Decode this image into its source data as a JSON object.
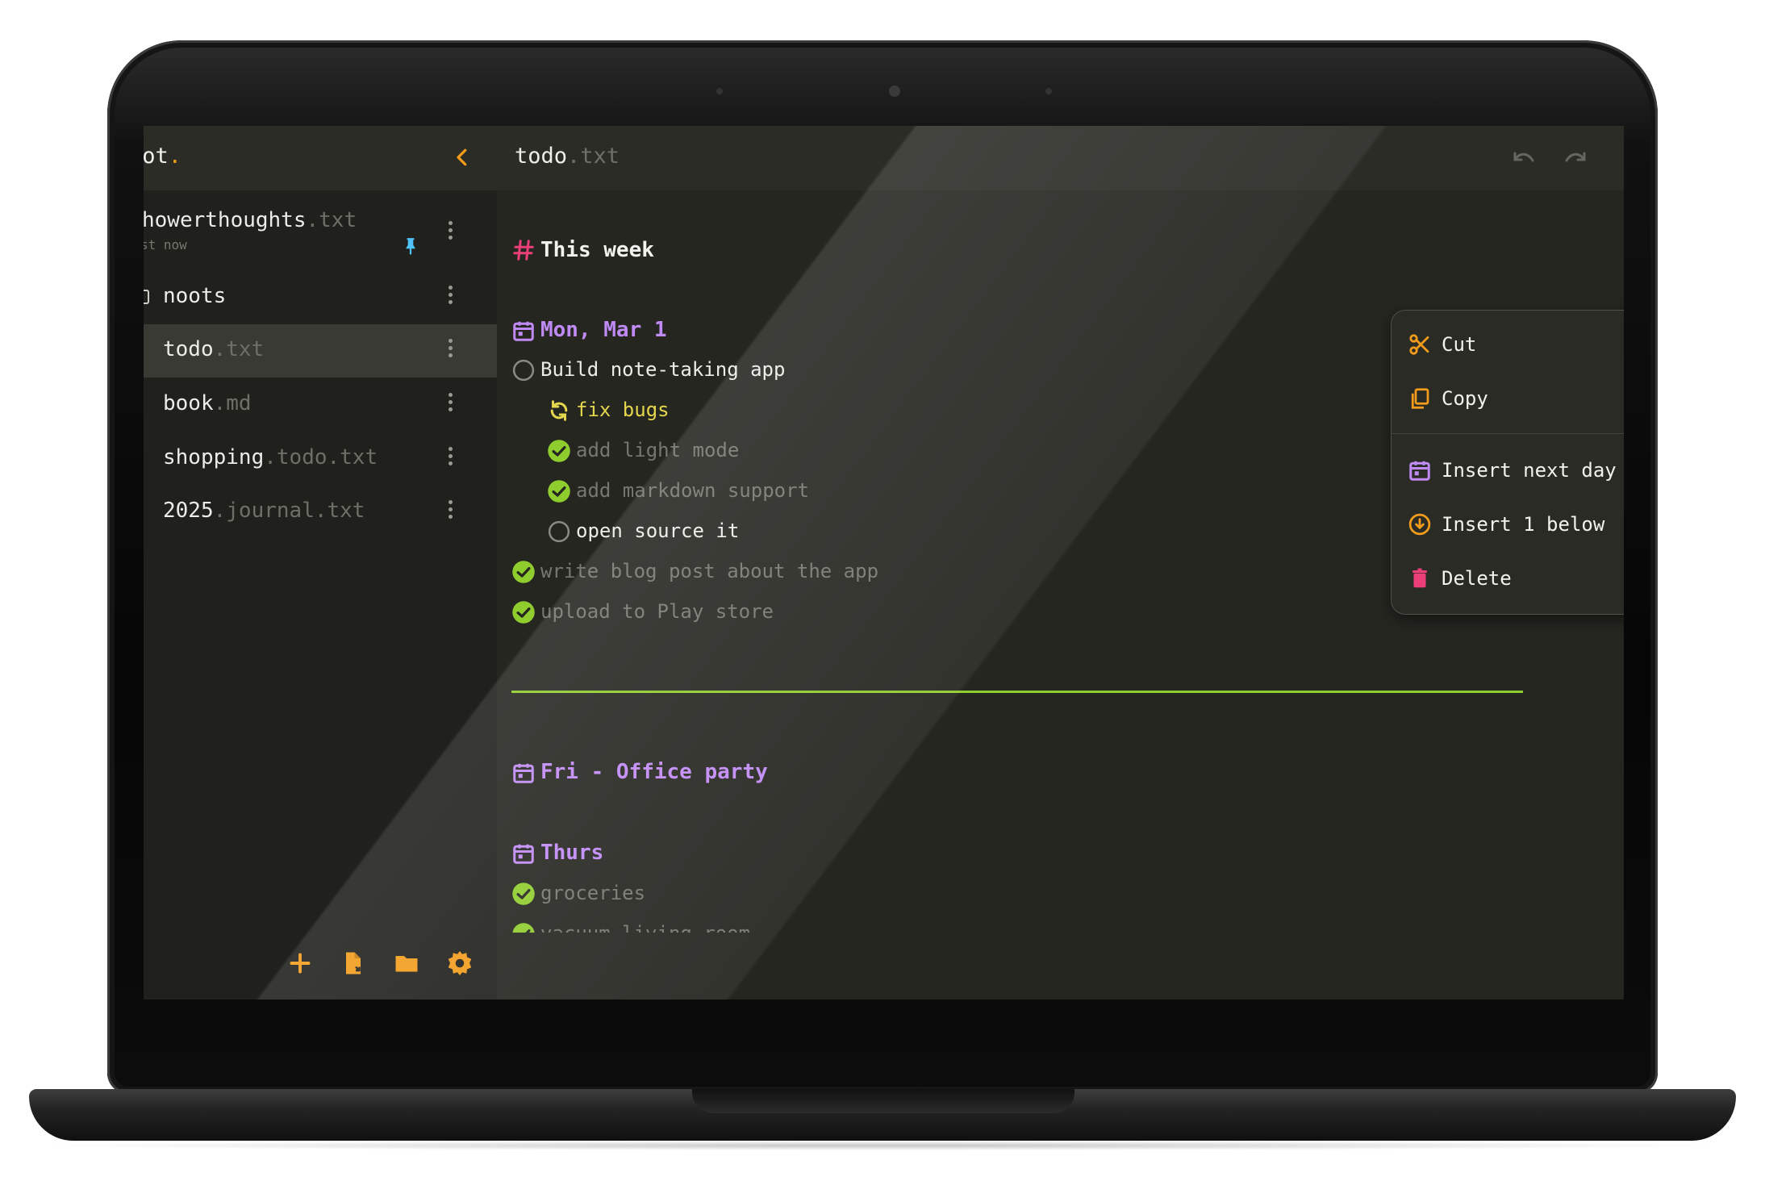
{
  "sidebar": {
    "brand": "oot",
    "brand_dot": ".",
    "items": [
      {
        "name": "howerthoughts",
        "ext": ".txt",
        "meta": "st now",
        "pinned": true
      },
      {
        "name": "noots",
        "ext": "",
        "type": "folder"
      },
      {
        "name": "todo",
        "ext": ".txt",
        "active": true
      },
      {
        "name": "book",
        "ext": ".md"
      },
      {
        "name": "shopping",
        "ext": ".todo.txt"
      },
      {
        "name": "2025",
        "ext": ".journal.txt"
      }
    ],
    "footer_icons": [
      "plus-icon",
      "new-file-icon",
      "folder-icon",
      "gear-icon"
    ]
  },
  "editor": {
    "title": "todo",
    "title_ext": ".txt",
    "header_icons": [
      "undo-icon",
      "redo-icon"
    ],
    "heading": "This week",
    "day1": "Mon, Mar 1",
    "tasks": [
      {
        "text": "Build note-taking app",
        "state": "open"
      },
      {
        "text": "fix bugs",
        "state": "in-progress"
      },
      {
        "text": "add light mode",
        "state": "done"
      },
      {
        "text": "add markdown support",
        "state": "done"
      },
      {
        "text": "open source it",
        "state": "open"
      },
      {
        "text": "write blog post about the app",
        "state": "done"
      },
      {
        "text": "upload to Play store",
        "state": "done"
      }
    ],
    "day2": "Fri - Office party",
    "day3": "Thurs",
    "tasks3": [
      {
        "text": "groceries",
        "state": "done"
      },
      {
        "text": "vacuum living room",
        "state": "done"
      }
    ]
  },
  "context_menu": {
    "items": [
      {
        "label": "Cut",
        "icon": "scissors-icon"
      },
      {
        "label": "Copy",
        "icon": "copy-icon"
      },
      {
        "label": "Insert next day",
        "icon": "calendar-icon"
      },
      {
        "label": "Insert 1 below",
        "icon": "insert-below-icon"
      },
      {
        "label": "Delete",
        "icon": "trash-icon"
      }
    ]
  },
  "colors": {
    "accent": "#f39c1c",
    "heading_hash": "#ec3f7a",
    "date": "#c08af5",
    "done": "#8fcd2e",
    "in_progress": "#e4d64d",
    "delete": "#ec3f7a",
    "pin": "#4fc3f7"
  }
}
